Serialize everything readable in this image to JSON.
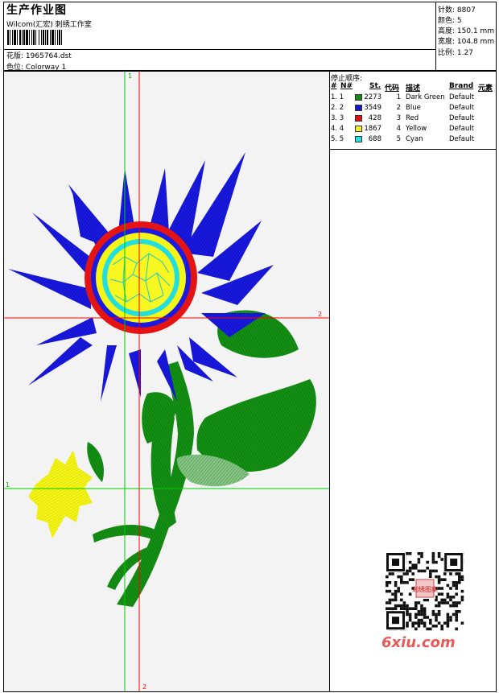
{
  "header": {
    "title": "生产作业图",
    "company": "Wilcom(汇宏) 刺绣工作室",
    "design_label": "花版:",
    "design_value": "1965764.dst",
    "colorway_label": "色位:",
    "colorway_value": "Colorway 1"
  },
  "stats": [
    {
      "label": "针数:",
      "value": "8807"
    },
    {
      "label": "颜色:",
      "value": "5"
    },
    {
      "label": "高度:",
      "value": "150.1 mm"
    },
    {
      "label": "宽度:",
      "value": "104.8 mm"
    },
    {
      "label": "比例:",
      "value": "1.27"
    }
  ],
  "stop_sequence": {
    "title": "停止顺序:",
    "columns": [
      "#",
      "N#",
      "St.",
      "代码",
      "描述",
      "Brand",
      "元素"
    ],
    "rows": [
      {
        "idx": "1. 1",
        "color": "#138a13",
        "stitches": "2273",
        "code": "1",
        "desc": "Dark Green",
        "brand": "Default"
      },
      {
        "idx": "2. 2",
        "color": "#1515d6",
        "stitches": "3549",
        "code": "2",
        "desc": "Blue",
        "brand": "Default"
      },
      {
        "idx": "3. 3",
        "color": "#e01010",
        "stitches": "428",
        "code": "3",
        "desc": "Red",
        "brand": "Default"
      },
      {
        "idx": "4. 4",
        "color": "#f2f21a",
        "stitches": "1867",
        "code": "4",
        "desc": "Yellow",
        "brand": "Default"
      },
      {
        "idx": "5. 5",
        "color": "#22e0e0",
        "stitches": "688",
        "code": "5",
        "desc": "Cyan",
        "brand": "Default"
      }
    ]
  },
  "axes": {
    "green_v": "1",
    "red_v": "2",
    "red_h": "2",
    "green_h": "1"
  },
  "watermark": "6xiu.com",
  "qr_seal": "刺绣图案"
}
